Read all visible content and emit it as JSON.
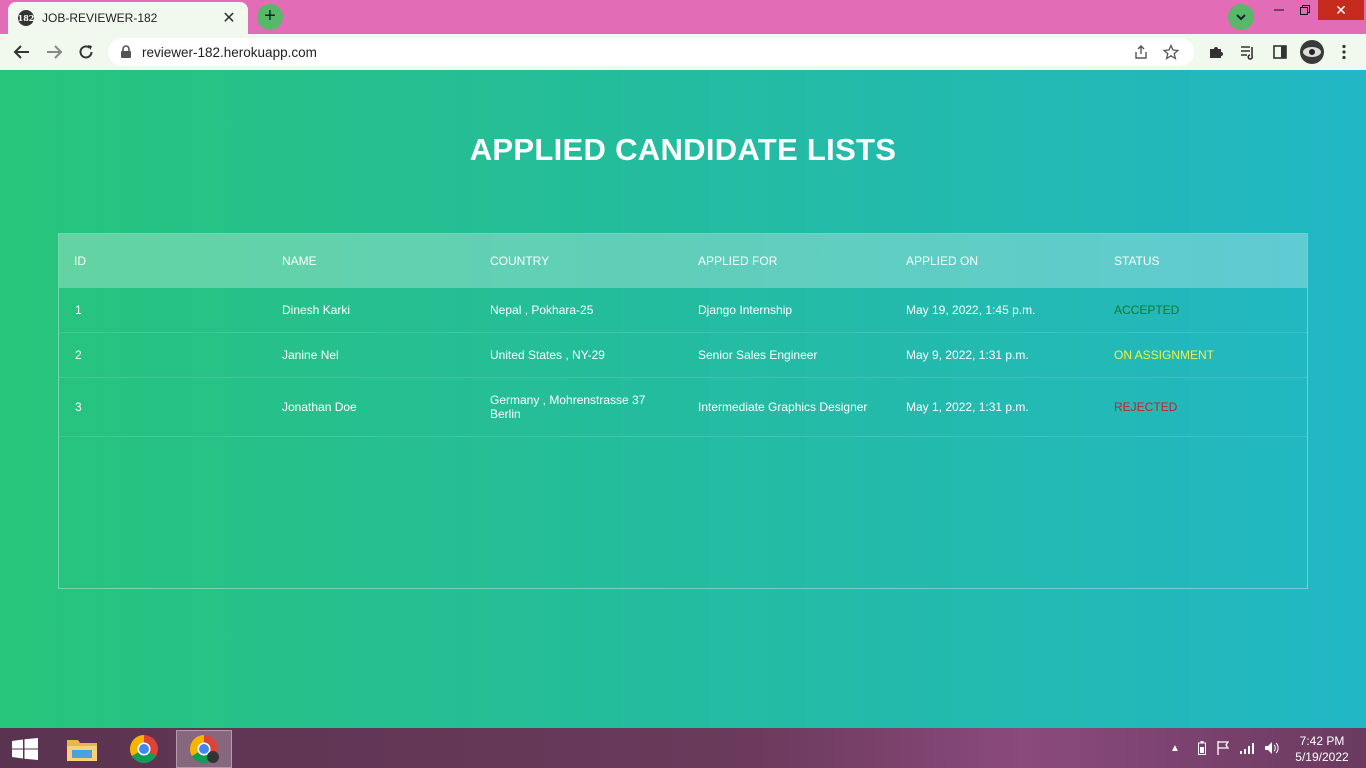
{
  "browser": {
    "tab_title": "JOB-REVIEWER-182",
    "tab_favicon_text": "182",
    "new_tab_label": "+",
    "url": "reviewer-182.herokuapp.com"
  },
  "page": {
    "title": "APPLIED CANDIDATE LISTS"
  },
  "table": {
    "headers": [
      "ID",
      "NAME",
      "COUNTRY",
      "APPLIED FOR",
      "APPLIED ON",
      "STATUS"
    ],
    "rows": [
      {
        "id": "1",
        "name": "Dinesh Karki",
        "country": "Nepal , Pokhara-25",
        "applied_for": "Django Internship",
        "applied_on": "May 19, 2022, 1:45 p.m.",
        "status": "ACCEPTED",
        "status_color": "#157a2c"
      },
      {
        "id": "2",
        "name": "Janine Nel",
        "country": "United States , NY-29",
        "applied_for": "Senior Sales Engineer",
        "applied_on": "May 9, 2022, 1:31 p.m.",
        "status": "ON ASSIGNMENT",
        "status_color": "#f2f23a"
      },
      {
        "id": "3",
        "name": "Jonathan Doe",
        "country": "Germany , Mohrenstrasse 37 Berlin",
        "applied_for": "Intermediate Graphics Designer",
        "applied_on": "May 1, 2022, 1:31 p.m.",
        "status": "REJECTED",
        "status_color": "#d11f1f"
      }
    ]
  },
  "taskbar": {
    "time": "7:42 PM",
    "date": "5/19/2022"
  },
  "colors": {
    "tabbar": "#e36cb6",
    "toolbar": "#f1f8ee",
    "gradient_start": "#27c47b",
    "gradient_end": "#22b7c5"
  }
}
